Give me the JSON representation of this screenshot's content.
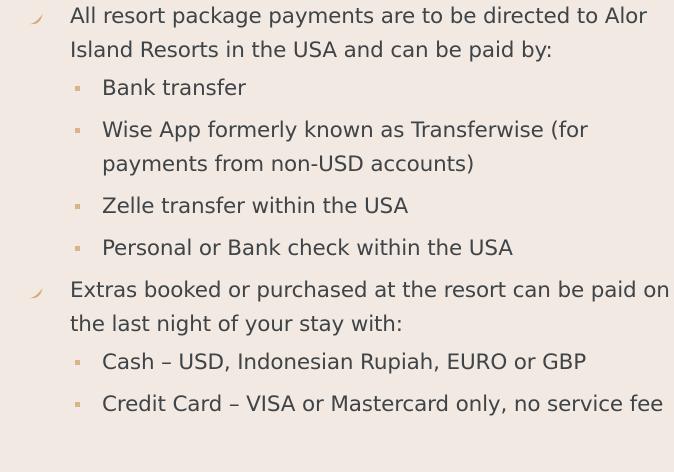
{
  "page": {
    "items": [
      {
        "icon": "leaf-icon",
        "text": "All resort package payments are to be directed to Alor Island Resorts in the USA and can be paid by:",
        "subitems": [
          "Bank transfer",
          "Wise App formerly known as Transferwise (for payments from non-USD accounts)",
          "Zelle transfer within the USA",
          "Personal or Bank check within the USA"
        ]
      },
      {
        "icon": "leaf-icon",
        "text": "Extras booked or purchased at the resort can be paid on the last night of your stay with:",
        "subitems": [
          "Cash – USD, Indonesian Rupiah, EURO or GBP",
          "Credit Card – VISA or Mastercard only, no service fee"
        ]
      }
    ]
  },
  "colors": {
    "background": "#f2e9e2",
    "text": "#3f4448",
    "icon": "#d0aa76",
    "bullet": "#d6b688"
  }
}
